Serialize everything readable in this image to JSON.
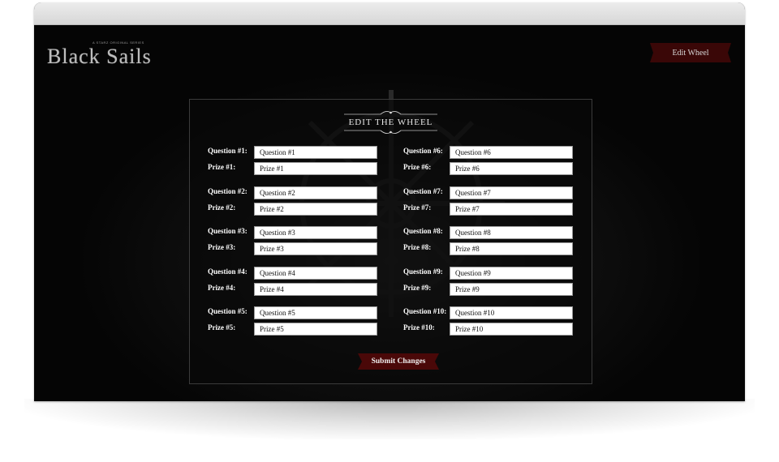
{
  "app": {
    "logo_tagline": "A STARZ ORIGINAL SERIES",
    "logo_title": "Black Sails"
  },
  "header": {
    "edit_wheel_label": "Edit Wheel"
  },
  "form": {
    "title": "EDIT THE WHEEL",
    "submit_label": "Submit Changes",
    "left_column": [
      {
        "question_label": "Question #1:",
        "question_value": "Question #1",
        "prize_label": "Prize #1:",
        "prize_value": "Prize #1"
      },
      {
        "question_label": "Question #2:",
        "question_value": "Question #2",
        "prize_label": "Prize #2:",
        "prize_value": "Prize #2"
      },
      {
        "question_label": "Question #3:",
        "question_value": "Question #3",
        "prize_label": "Prize #3:",
        "prize_value": "Prize #3"
      },
      {
        "question_label": "Question #4:",
        "question_value": "Question #4",
        "prize_label": "Prize #4:",
        "prize_value": "Prize #4"
      },
      {
        "question_label": "Question #5:",
        "question_value": "Question #5",
        "prize_label": "Prize #5:",
        "prize_value": "Prize #5"
      }
    ],
    "right_column": [
      {
        "question_label": "Question #6:",
        "question_value": "Question #6",
        "prize_label": "Prize #6:",
        "prize_value": "Prize #6"
      },
      {
        "question_label": "Question #7:",
        "question_value": "Question #7",
        "prize_label": "Prize #7:",
        "prize_value": "Prize #7"
      },
      {
        "question_label": "Question #8:",
        "question_value": "Question #8",
        "prize_label": "Prize #8:",
        "prize_value": "Prize #8"
      },
      {
        "question_label": "Question #9:",
        "question_value": "Question #9",
        "prize_label": "Prize #9:",
        "prize_value": "Prize #9"
      },
      {
        "question_label": "Question #10:",
        "question_value": "Question #10",
        "prize_label": "Prize #10:",
        "prize_value": "Prize #10"
      }
    ]
  },
  "colors": {
    "background": "#050505",
    "accent_button": "#4a0808",
    "text": "#ffffff"
  }
}
